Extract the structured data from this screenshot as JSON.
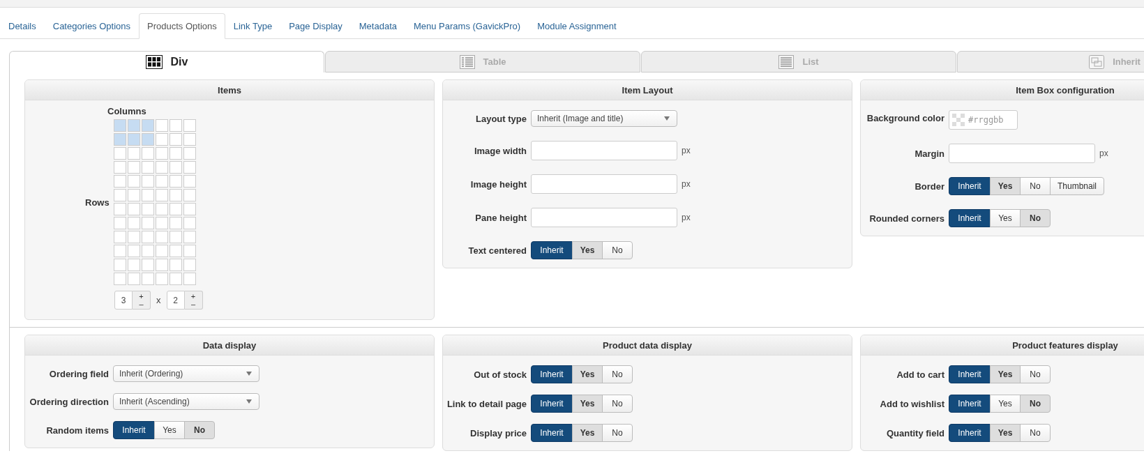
{
  "top_tabs": [
    {
      "label": "Details",
      "selected": false
    },
    {
      "label": "Categories Options",
      "selected": false
    },
    {
      "label": "Products Options",
      "selected": true
    },
    {
      "label": "Link Type",
      "selected": false
    },
    {
      "label": "Page Display",
      "selected": false
    },
    {
      "label": "Metadata",
      "selected": false
    },
    {
      "label": "Menu Params (GavickPro)",
      "selected": false
    },
    {
      "label": "Module Assignment",
      "selected": false
    }
  ],
  "layout_tabs": [
    {
      "label": "Div",
      "kind": "div",
      "selected": true
    },
    {
      "label": "Table",
      "kind": "table",
      "selected": false
    },
    {
      "label": "List",
      "kind": "list",
      "selected": false
    },
    {
      "label": "Inherit",
      "kind": "inherit",
      "selected": false
    }
  ],
  "panel_rows": [
    [
      {
        "title": "Items",
        "kind": "items",
        "columns_label": "Columns",
        "rows_label": "Rows",
        "separator": "x",
        "grid": [
          {
            "cells": [
              {
                "selected": true
              },
              {
                "selected": true
              },
              {
                "selected": true
              },
              {
                "selected": false
              },
              {
                "selected": false
              },
              {
                "selected": false
              }
            ]
          },
          {
            "cells": [
              {
                "selected": true
              },
              {
                "selected": true
              },
              {
                "selected": true
              },
              {
                "selected": false
              },
              {
                "selected": false
              },
              {
                "selected": false
              }
            ]
          },
          {
            "cells": [
              {
                "selected": false
              },
              {
                "selected": false
              },
              {
                "selected": false
              },
              {
                "selected": false
              },
              {
                "selected": false
              },
              {
                "selected": false
              }
            ]
          },
          {
            "cells": [
              {
                "selected": false
              },
              {
                "selected": false
              },
              {
                "selected": false
              },
              {
                "selected": false
              },
              {
                "selected": false
              },
              {
                "selected": false
              }
            ]
          },
          {
            "cells": [
              {
                "selected": false
              },
              {
                "selected": false
              },
              {
                "selected": false
              },
              {
                "selected": false
              },
              {
                "selected": false
              },
              {
                "selected": false
              }
            ]
          },
          {
            "cells": [
              {
                "selected": false
              },
              {
                "selected": false
              },
              {
                "selected": false
              },
              {
                "selected": false
              },
              {
                "selected": false
              },
              {
                "selected": false
              }
            ]
          },
          {
            "cells": [
              {
                "selected": false
              },
              {
                "selected": false
              },
              {
                "selected": false
              },
              {
                "selected": false
              },
              {
                "selected": false
              },
              {
                "selected": false
              }
            ]
          },
          {
            "cells": [
              {
                "selected": false
              },
              {
                "selected": false
              },
              {
                "selected": false
              },
              {
                "selected": false
              },
              {
                "selected": false
              },
              {
                "selected": false
              }
            ]
          },
          {
            "cells": [
              {
                "selected": false
              },
              {
                "selected": false
              },
              {
                "selected": false
              },
              {
                "selected": false
              },
              {
                "selected": false
              },
              {
                "selected": false
              }
            ]
          },
          {
            "cells": [
              {
                "selected": false
              },
              {
                "selected": false
              },
              {
                "selected": false
              },
              {
                "selected": false
              },
              {
                "selected": false
              },
              {
                "selected": false
              }
            ]
          },
          {
            "cells": [
              {
                "selected": false
              },
              {
                "selected": false
              },
              {
                "selected": false
              },
              {
                "selected": false
              },
              {
                "selected": false
              },
              {
                "selected": false
              }
            ]
          },
          {
            "cells": [
              {
                "selected": false
              },
              {
                "selected": false
              },
              {
                "selected": false
              },
              {
                "selected": false
              },
              {
                "selected": false
              },
              {
                "selected": false
              }
            ]
          }
        ],
        "spinners": [
          {
            "value": "3",
            "up": "+",
            "down": "–"
          },
          {
            "value": "2",
            "up": "+",
            "down": "–"
          }
        ]
      },
      {
        "title": "Item Layout",
        "kind": "form",
        "fields": [
          {
            "kind": "select",
            "label": "Layout type",
            "value": "Inherit (Image and title)"
          },
          {
            "kind": "text",
            "label": "Image width",
            "unit": "px"
          },
          {
            "kind": "text",
            "label": "Image height",
            "unit": "px"
          },
          {
            "kind": "text",
            "label": "Pane height",
            "unit": "px"
          },
          {
            "kind": "toggle",
            "label": "Text centered",
            "options": [
              {
                "label": "Inherit",
                "selected": true,
                "highlighted": false
              },
              {
                "label": "Yes",
                "selected": false,
                "highlighted": true
              },
              {
                "label": "No",
                "selected": false,
                "highlighted": false
              }
            ]
          }
        ]
      },
      {
        "title": "Item Box configuration",
        "kind": "form",
        "fields": [
          {
            "kind": "color",
            "label": "Background color",
            "placeholder": "#rrggbb"
          },
          {
            "kind": "text",
            "label": "Margin",
            "unit": "px"
          },
          {
            "kind": "toggle",
            "label": "Border",
            "options": [
              {
                "label": "Inherit",
                "selected": true,
                "highlighted": false
              },
              {
                "label": "Yes",
                "selected": false,
                "highlighted": true
              },
              {
                "label": "No",
                "selected": false,
                "highlighted": false
              },
              {
                "label": "Thumbnail",
                "selected": false,
                "highlighted": false
              }
            ]
          },
          {
            "kind": "toggle",
            "label": "Rounded corners",
            "options": [
              {
                "label": "Inherit",
                "selected": true,
                "highlighted": false
              },
              {
                "label": "Yes",
                "selected": false,
                "highlighted": false
              },
              {
                "label": "No",
                "selected": false,
                "highlighted": true
              }
            ]
          }
        ]
      }
    ],
    [
      {
        "title": "Data display",
        "kind": "form",
        "fields": [
          {
            "kind": "select",
            "label": "Ordering field",
            "value": "Inherit (Ordering)"
          },
          {
            "kind": "select",
            "label": "Ordering direction",
            "value": "Inherit (Ascending)"
          },
          {
            "kind": "toggle",
            "label": "Random items",
            "options": [
              {
                "label": "Inherit",
                "selected": true,
                "highlighted": false
              },
              {
                "label": "Yes",
                "selected": false,
                "highlighted": false
              },
              {
                "label": "No",
                "selected": false,
                "highlighted": true
              }
            ]
          }
        ]
      },
      {
        "title": "Product data display",
        "kind": "form",
        "fields": [
          {
            "kind": "toggle",
            "label": "Out of stock",
            "options": [
              {
                "label": "Inherit",
                "selected": true,
                "highlighted": false
              },
              {
                "label": "Yes",
                "selected": false,
                "highlighted": true
              },
              {
                "label": "No",
                "selected": false,
                "highlighted": false
              }
            ]
          },
          {
            "kind": "toggle",
            "label": "Link to detail page",
            "options": [
              {
                "label": "Inherit",
                "selected": true,
                "highlighted": false
              },
              {
                "label": "Yes",
                "selected": false,
                "highlighted": true
              },
              {
                "label": "No",
                "selected": false,
                "highlighted": false
              }
            ]
          },
          {
            "kind": "toggle",
            "label": "Display price",
            "options": [
              {
                "label": "Inherit",
                "selected": true,
                "highlighted": false
              },
              {
                "label": "Yes",
                "selected": false,
                "highlighted": true
              },
              {
                "label": "No",
                "selected": false,
                "highlighted": false
              }
            ]
          }
        ]
      },
      {
        "title": "Product features display",
        "kind": "form",
        "fields": [
          {
            "kind": "toggle",
            "label": "Add to cart",
            "options": [
              {
                "label": "Inherit",
                "selected": true,
                "highlighted": false
              },
              {
                "label": "Yes",
                "selected": false,
                "highlighted": true
              },
              {
                "label": "No",
                "selected": false,
                "highlighted": false
              }
            ]
          },
          {
            "kind": "toggle",
            "label": "Add to wishlist",
            "options": [
              {
                "label": "Inherit",
                "selected": true,
                "highlighted": false
              },
              {
                "label": "Yes",
                "selected": false,
                "highlighted": false
              },
              {
                "label": "No",
                "selected": false,
                "highlighted": true
              }
            ]
          },
          {
            "kind": "toggle",
            "label": "Quantity field",
            "options": [
              {
                "label": "Inherit",
                "selected": true,
                "highlighted": false
              },
              {
                "label": "Yes",
                "selected": false,
                "highlighted": true
              },
              {
                "label": "No",
                "selected": false,
                "highlighted": false
              }
            ]
          }
        ]
      }
    ]
  ]
}
